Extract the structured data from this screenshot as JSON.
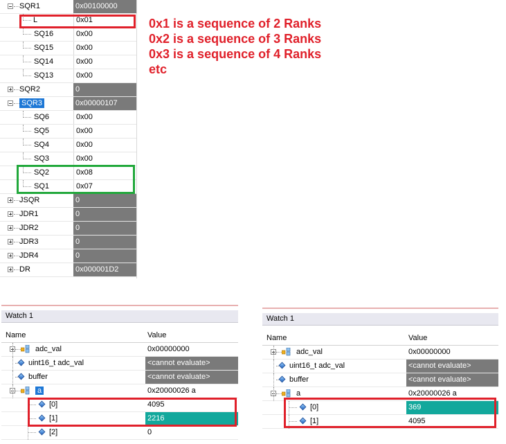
{
  "registers": [
    {
      "label": "SQR1",
      "value": "0x00100000",
      "expander": "minus",
      "style": "dark"
    },
    {
      "label": "L",
      "value": "0x01",
      "style": "light",
      "child": true
    },
    {
      "label": "SQ16",
      "value": "0x00",
      "style": "light",
      "child": true
    },
    {
      "label": "SQ15",
      "value": "0x00",
      "style": "light",
      "child": true
    },
    {
      "label": "SQ14",
      "value": "0x00",
      "style": "light",
      "child": true
    },
    {
      "label": "SQ13",
      "value": "0x00",
      "style": "light",
      "child": true
    },
    {
      "label": "SQR2",
      "value": "0",
      "expander": "plus",
      "style": "dark"
    },
    {
      "label": "SQR3",
      "value": "0x00000107",
      "expander": "minus",
      "style": "dark",
      "selected": true
    },
    {
      "label": "SQ6",
      "value": "0x00",
      "style": "light",
      "child": true
    },
    {
      "label": "SQ5",
      "value": "0x00",
      "style": "light",
      "child": true
    },
    {
      "label": "SQ4",
      "value": "0x00",
      "style": "light",
      "child": true
    },
    {
      "label": "SQ3",
      "value": "0x00",
      "style": "light",
      "child": true
    },
    {
      "label": "SQ2",
      "value": "0x08",
      "style": "light",
      "child": true
    },
    {
      "label": "SQ1",
      "value": "0x07",
      "style": "light",
      "child": true
    },
    {
      "label": "JSQR",
      "value": "0",
      "expander": "plus",
      "style": "dark"
    },
    {
      "label": "JDR1",
      "value": "0",
      "expander": "plus",
      "style": "dark"
    },
    {
      "label": "JDR2",
      "value": "0",
      "expander": "plus",
      "style": "dark"
    },
    {
      "label": "JDR3",
      "value": "0",
      "expander": "plus",
      "style": "dark"
    },
    {
      "label": "JDR4",
      "value": "0",
      "expander": "plus",
      "style": "dark"
    },
    {
      "label": "DR",
      "value": "0x000001D2",
      "expander": "plus",
      "style": "dark"
    }
  ],
  "notes": [
    "0x1 is a sequence of 2 Ranks",
    "0x2 is a sequence of 3 Ranks",
    "0x3 is a sequence of 4 Ranks",
    "etc"
  ],
  "watch_left": {
    "title": "Watch 1",
    "col_name": "Name",
    "col_value": "Value",
    "rows": [
      {
        "name": "adc_val",
        "value": "0x00000000",
        "icon": "struct",
        "expander": "plus",
        "style": "white"
      },
      {
        "name": "uint16_t adc_val",
        "value": "<cannot evaluate>",
        "icon": "var",
        "style": "gray"
      },
      {
        "name": "buffer",
        "value": "<cannot evaluate>",
        "icon": "var",
        "style": "gray"
      },
      {
        "name": "a",
        "value": "0x20000026 a",
        "icon": "struct",
        "expander": "minus",
        "style": "white",
        "selected": true
      },
      {
        "name": "[0]",
        "value": "4095",
        "icon": "var",
        "child": true,
        "style": "white"
      },
      {
        "name": "[1]",
        "value": "2216",
        "icon": "var",
        "child": true,
        "style": "teal"
      },
      {
        "name": "[2]",
        "value": "0",
        "icon": "var",
        "child": true,
        "style": "white"
      }
    ]
  },
  "watch_right": {
    "title": "Watch 1",
    "col_name": "Name",
    "col_value": "Value",
    "rows": [
      {
        "name": "adc_val",
        "value": "0x00000000",
        "icon": "struct",
        "expander": "plus",
        "style": "white"
      },
      {
        "name": "uint16_t adc_val",
        "value": "<cannot evaluate>",
        "icon": "var",
        "style": "gray"
      },
      {
        "name": "buffer",
        "value": "<cannot evaluate>",
        "icon": "var",
        "style": "gray"
      },
      {
        "name": "a",
        "value": "0x20000026 a",
        "icon": "struct",
        "expander": "minus",
        "style": "white"
      },
      {
        "name": "[0]",
        "value": "369",
        "icon": "var",
        "child": true,
        "style": "teal"
      },
      {
        "name": "[1]",
        "value": "4095",
        "icon": "var",
        "child": true,
        "style": "white"
      }
    ]
  },
  "colors": {
    "annotation_red": "#e0202a",
    "annotation_green": "#21a83b",
    "selection_blue": "#1e78d6",
    "changed_teal": "#12a89c",
    "readonly_gray": "#7a7a7a"
  }
}
